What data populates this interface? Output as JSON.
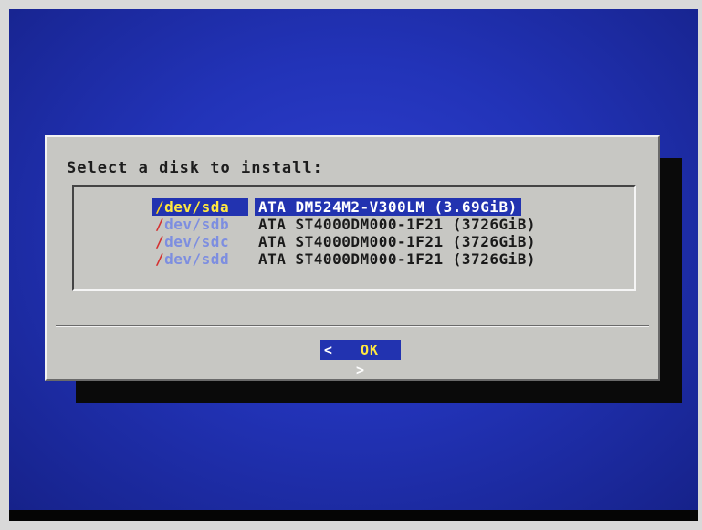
{
  "dialog": {
    "prompt": "Select a disk to install:",
    "disks": [
      {
        "slash": "/",
        "path": "dev/sda",
        "description": "ATA DM524M2-V300LM (3.69GiB)",
        "selected": true
      },
      {
        "slash": "/",
        "path": "dev/sdb",
        "description": "ATA ST4000DM000-1F21 (3726GiB)",
        "selected": false
      },
      {
        "slash": "/",
        "path": "dev/sdc",
        "description": "ATA ST4000DM000-1F21 (3726GiB)",
        "selected": false
      },
      {
        "slash": "/",
        "path": "dev/sdd",
        "description": "ATA ST4000DM000-1F21 (3726GiB)",
        "selected": false
      }
    ],
    "ok_button": {
      "left": "<",
      "label": "OK",
      "right": ">"
    }
  },
  "colors": {
    "screen_background": "#2233b8",
    "dialog_background": "#c7c7c3",
    "selection": "#2233b0",
    "selected_text": "#ffe840",
    "device_text": "#7d8ee0",
    "slash": "#d43030"
  }
}
